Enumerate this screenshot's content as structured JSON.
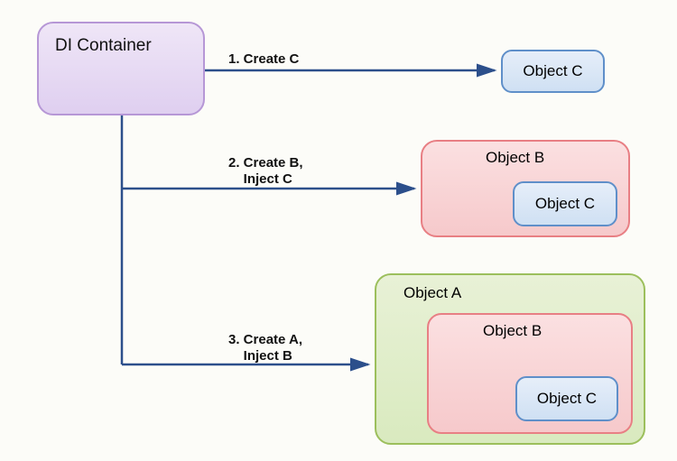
{
  "di_container": {
    "label": "DI Container"
  },
  "steps": {
    "s1": {
      "label": "1. Create C"
    },
    "s2": {
      "label": "2. Create B,\n    Inject C"
    },
    "s3": {
      "label": "3. Create A,\n    Inject B"
    }
  },
  "objects": {
    "c1": "Object C",
    "b1": "Object B",
    "c2": "Object C",
    "a": "Object A",
    "b2": "Object B",
    "c3": "Object C"
  },
  "colors": {
    "arrow": "#2c4f8b"
  }
}
